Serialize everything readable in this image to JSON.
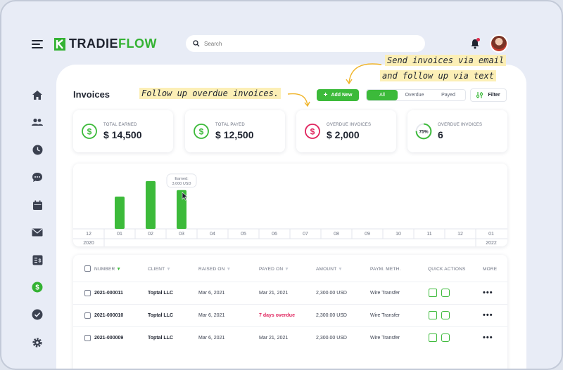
{
  "app": {
    "logo_left": "TRADIE",
    "logo_right": "FLOW",
    "search_placeholder": "Search"
  },
  "page": {
    "title": "Invoices",
    "add_new": "Add New",
    "tabs": [
      "All",
      "Overdue",
      "Payed"
    ],
    "active_tab": "All",
    "filter": "Filter"
  },
  "annotations": {
    "note_1": "Follow up overdue invoices.",
    "note_2a": "Send invoices via email",
    "note_2b": "and follow up via text"
  },
  "cards": [
    {
      "label": "TOTAL EARNED",
      "value": "$ 14,500",
      "color": "#3cba3a",
      "icon": "dollar-icon"
    },
    {
      "label": "TOTAL PAYED",
      "value": "$ 12,500",
      "color": "#3cba3a",
      "icon": "dollar-icon"
    },
    {
      "label": "OVERDUE INVOICES",
      "value": "$ 2,000",
      "color": "#e0245e",
      "icon": "dollar-icon"
    },
    {
      "label": "OVERDUE INVOICES",
      "value": "6",
      "ring_text": "75%",
      "ring_fraction": 0.75,
      "color": "#3cba3a",
      "icon": "progress-ring-icon"
    }
  ],
  "chart_data": {
    "type": "bar",
    "categories": [
      "12",
      "01",
      "02",
      "03",
      "04",
      "05",
      "06",
      "07",
      "08",
      "09",
      "10",
      "11",
      "12",
      "01"
    ],
    "year_labels": [
      "2020",
      "2022"
    ],
    "values": [
      0,
      2500,
      3700,
      3000,
      0,
      0,
      0,
      0,
      0,
      0,
      0,
      0,
      0,
      0
    ],
    "ylim": [
      0,
      4400
    ],
    "tooltip": {
      "category_index": 3,
      "line1": "Earned:",
      "line2": "3,000 USD"
    },
    "bar_color": "#3cba3a"
  },
  "table": {
    "headers": [
      "NUMBER",
      "CLIENT",
      "RAISED ON",
      "PAYED ON",
      "AMOUNT",
      "PAYM. METH.",
      "QUICK ACTIONS",
      "MORE"
    ],
    "rows": [
      {
        "number": "2021-000011",
        "client": "Toptal LLC",
        "raised": "Mar 6, 2021",
        "payed": "Mar 21, 2021",
        "amount": "2,300.00 USD",
        "method": "Wire Transfer",
        "payed_overdue": false
      },
      {
        "number": "2021-000010",
        "client": "Toptal LLC",
        "raised": "Mar 6, 2021",
        "payed": "7 days overdue",
        "amount": "2,300.00 USD",
        "method": "Wire Transfer",
        "payed_overdue": true
      },
      {
        "number": "2021-000009",
        "client": "Toptal LLC",
        "raised": "Mar 6, 2021",
        "payed": "Mar 21, 2021",
        "amount": "2,300.00 USD",
        "method": "Wire Transfer",
        "payed_overdue": false
      }
    ],
    "more_glyph": "•••"
  },
  "colors": {
    "accent": "#3cba3a",
    "danger": "#e0245e",
    "highlight": "#fcefb6"
  }
}
